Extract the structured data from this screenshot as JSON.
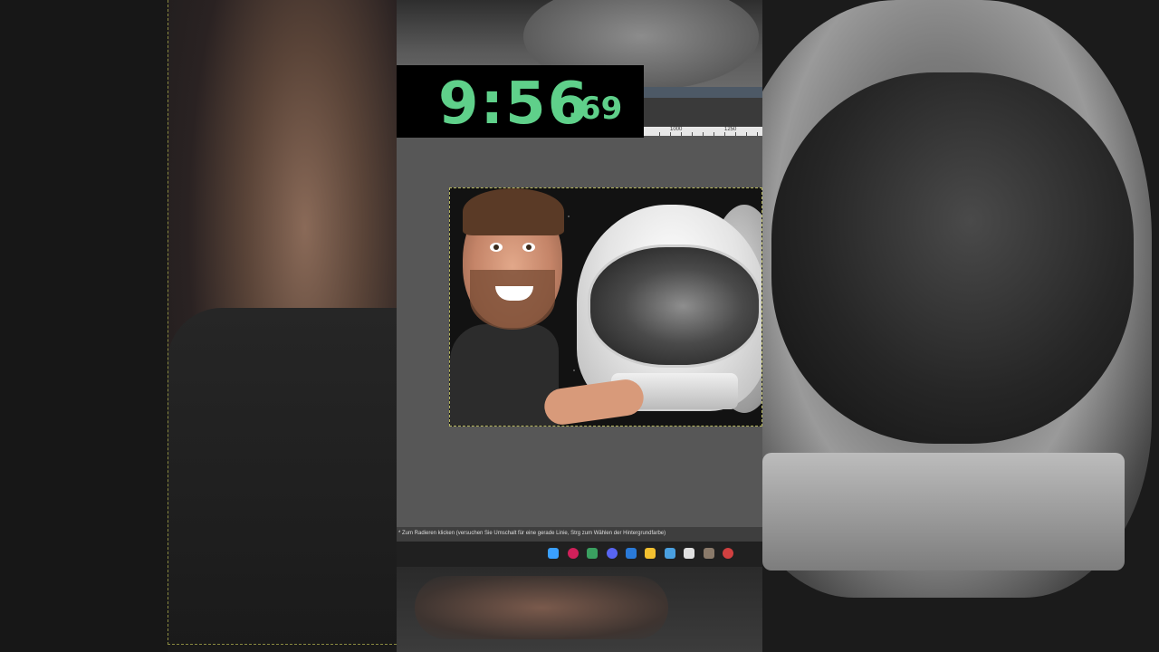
{
  "timer": {
    "main": "9:56",
    "fraction": ".69"
  },
  "ruler": {
    "marks": [
      "1000",
      "1250"
    ]
  },
  "statusbar": {
    "text": "* Zum Radieren klicken (versuchen Sie Umschalt für eine gerade Linie, Strg zum Wählen der Hintergrundfarbe)"
  },
  "taskbar": {
    "icons": [
      {
        "name": "windows-start-icon",
        "color": "#3aa0ff"
      },
      {
        "name": "app-red-icon",
        "color": "#d0205a"
      },
      {
        "name": "app-green-icon",
        "color": "#3aa060"
      },
      {
        "name": "discord-icon",
        "color": "#5865f2"
      },
      {
        "name": "app-blue-icon",
        "color": "#2a7ad8"
      },
      {
        "name": "folder-icon",
        "color": "#f2c030"
      },
      {
        "name": "app-fox-icon",
        "color": "#4aa0e0"
      },
      {
        "name": "app-doc-icon",
        "color": "#e0e0e0"
      },
      {
        "name": "gimp-icon",
        "color": "#8a7a6a"
      },
      {
        "name": "app-chrome-icon",
        "color": "#d04040"
      }
    ]
  },
  "colors": {
    "timer": "#5fd08a",
    "selection": "#b8b860"
  }
}
